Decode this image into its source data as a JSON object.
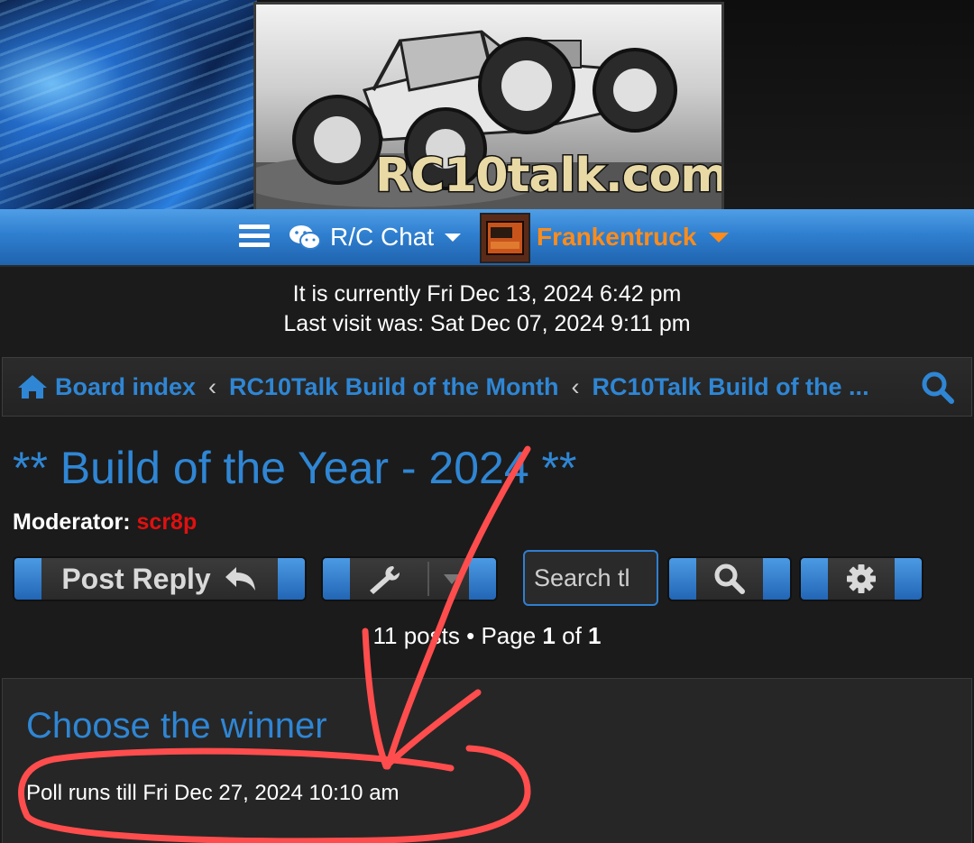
{
  "header": {
    "logo_text": "RC10talk.com"
  },
  "nav": {
    "menu_icon": "hamburger-icon",
    "forum_label": "R/C Chat",
    "username": "Frankentruck",
    "user_color": "#ff8c1a"
  },
  "time": {
    "current": "It is currently Fri Dec 13, 2024 6:42 pm",
    "last_visit": "Last visit was: Sat Dec 07, 2024 9:11 pm"
  },
  "breadcrumb": {
    "items": [
      "Board index",
      "RC10Talk Build of the Month",
      "RC10Talk Build of the ..."
    ],
    "separator": "‹"
  },
  "topic": {
    "title": "** Build of the Year - 2024 **",
    "moderator_label": "Moderator:",
    "moderator_name": "scr8p",
    "moderator_color": "#e01010"
  },
  "actions": {
    "post_reply": "Post Reply",
    "search_placeholder": "Search this topic…",
    "search_value": "Search tl"
  },
  "pagination": {
    "posts": "11 posts",
    "bullet": "•",
    "page_label": "Page",
    "page": "1",
    "of_label": "of",
    "total": "1"
  },
  "poll": {
    "title": "Choose the winner",
    "runs_until": "Poll runs till Fri Dec 27, 2024 10:10 am"
  },
  "colors": {
    "link": "#2f86d4",
    "accent_blue": "#2f7fd0",
    "annotation_red": "#ff4d4d"
  }
}
